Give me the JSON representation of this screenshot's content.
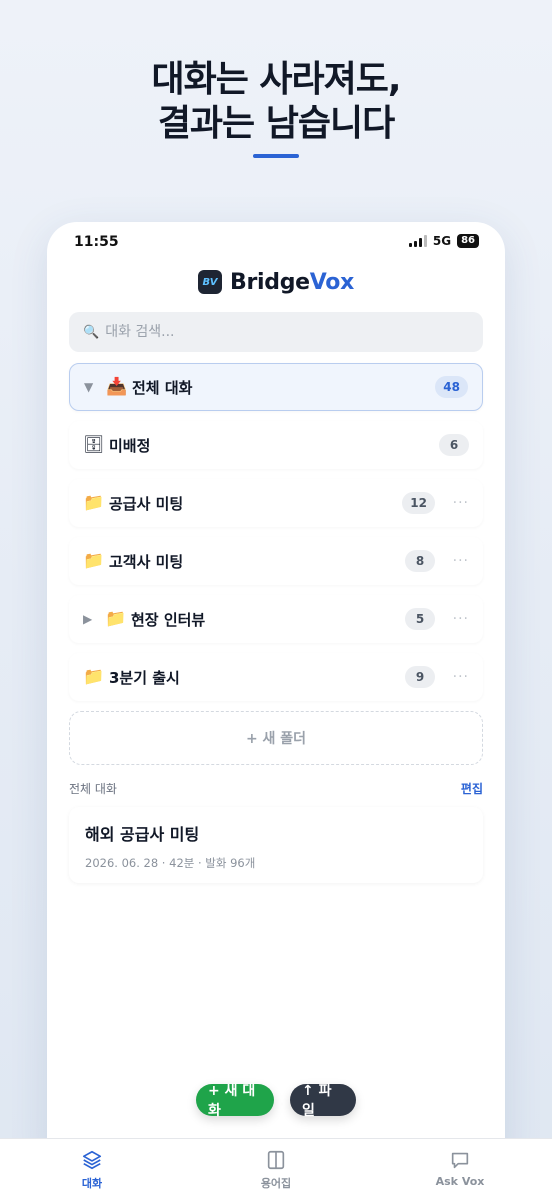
{
  "headline": {
    "line1": "대화는 사라져도,",
    "line2": "결과는 남습니다"
  },
  "status": {
    "time": "11:55",
    "network": "5G",
    "battery": "86"
  },
  "brand": {
    "logo_text": "BV",
    "name_part1": "Bridge",
    "name_part2": "Vox"
  },
  "search": {
    "placeholder": "대화 검색..."
  },
  "folders": [
    {
      "label": "전체 대화",
      "count": "48",
      "icon": "inbox-tray-icon",
      "glyph": "📥",
      "caret": "▼"
    },
    {
      "label": "미배정",
      "count": "6",
      "icon": "cabinet-icon",
      "glyph": "🗄"
    },
    {
      "label": "공급사 미팅",
      "count": "12",
      "icon": "folder-icon",
      "glyph": "📁",
      "more": "···"
    },
    {
      "label": "고객사 미팅",
      "count": "8",
      "icon": "folder-icon",
      "glyph": "📁",
      "more": "···"
    },
    {
      "label": "현장 인터뷰",
      "count": "5",
      "icon": "folder-icon",
      "glyph": "📁",
      "caret": "▶",
      "more": "···"
    },
    {
      "label": "3분기 출시",
      "count": "9",
      "icon": "folder-icon",
      "glyph": "📁",
      "more": "···"
    }
  ],
  "new_folder": {
    "label": "+ 새 폴더"
  },
  "section": {
    "title": "전체 대화",
    "edit": "편집"
  },
  "conversations": [
    {
      "title": "해외 공급사 미팅",
      "meta": "2026. 06. 28 · 42분 · 발화 96개"
    }
  ],
  "fab": {
    "new_chat": "+ 새 대화",
    "file": "↑ 파일"
  },
  "tabs": [
    {
      "label": "대화",
      "icon": "layers-icon",
      "active": true
    },
    {
      "label": "용어집",
      "icon": "book-icon",
      "active": false
    },
    {
      "label": "Ask Vox",
      "icon": "chat-bubble-icon",
      "active": false
    }
  ],
  "colors": {
    "accent": "#2b63d4",
    "green": "#1fa44a",
    "dark": "#303846"
  }
}
